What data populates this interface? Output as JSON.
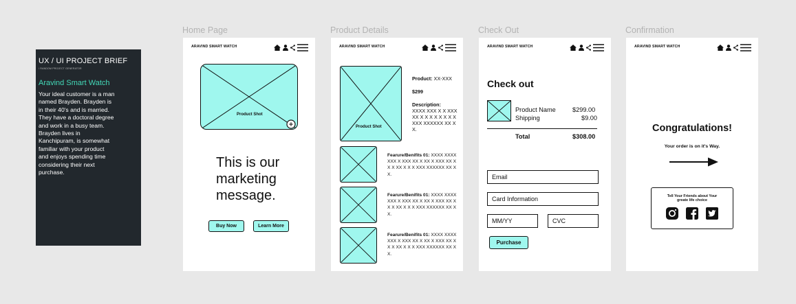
{
  "brief": {
    "title": "UX / UI PROJECT BRIEF",
    "subtitle": "/ RANDOM PROJECT GENERATOR",
    "product": "Aravind Smart Watch",
    "description": "Your ideal customer is a man named Brayden. Brayden is in their 40's and is married. They have a doctoral degree and work in a busy team. Brayden lives in Kanchipuram, is somewhat familiar with your product and enjoys spending time considering their next purchase."
  },
  "frames": {
    "home": "Home Page",
    "product": "Product Details",
    "checkout": "Check Out",
    "confirmation": "Confirmation"
  },
  "brand": "ARAVIND SMART WATCH",
  "home": {
    "product_shot": "Product Shot",
    "marketing": "This is our marketing message.",
    "buy_now": "Buy Now",
    "learn_more": "Learn More"
  },
  "product": {
    "product_shot": "Product Shot",
    "product_label": "Product:",
    "product_value": "XX-XXX",
    "price": "$299",
    "description_label": "Description:",
    "description_text": "XXXX XXX X X XXX XX X X X X X X X X XXX XXXXXX XX X X.",
    "features": [
      {
        "label": "Fearure/Benifits 01:",
        "text": "XXXX XXXX XXX X XXX XX X XX X XXX XX X X X XX X X X XXX XXXXXX XX X X."
      },
      {
        "label": "Fearure/Benifits 01:",
        "text": "XXXX XXXX XXX X XXX XX X XX X XXX XX X X X XX X X X XXX XXXXXX XX X X."
      },
      {
        "label": "Fearure/Benifits 01:",
        "text": "XXXX XXXX XXX X XXX XX X XX X XXX XX X X X XX X X X XXX XXXXXX XX X X."
      }
    ]
  },
  "checkout": {
    "title": "Check out",
    "product_name": "Product Name",
    "product_price": "$299.00",
    "shipping": "Shipping",
    "shipping_price": "$9.00",
    "total_label": "Total",
    "total_value": "$308.00",
    "email_placeholder": "Email",
    "card_placeholder": "Card Information",
    "expiry_placeholder": "MM/YY",
    "cvc_placeholder": "CVC",
    "purchase": "Purchase"
  },
  "confirmation": {
    "title": "Congratulations!",
    "message": "Your order is on it's Way.",
    "share_text": "Tell Your Friends about Your greate life choice"
  },
  "icons": [
    "home-icon",
    "user-icon",
    "share-icon",
    "menu-icon",
    "zoom-icon",
    "arrow-right-icon",
    "instagram-icon",
    "facebook-icon",
    "twitter-icon"
  ]
}
